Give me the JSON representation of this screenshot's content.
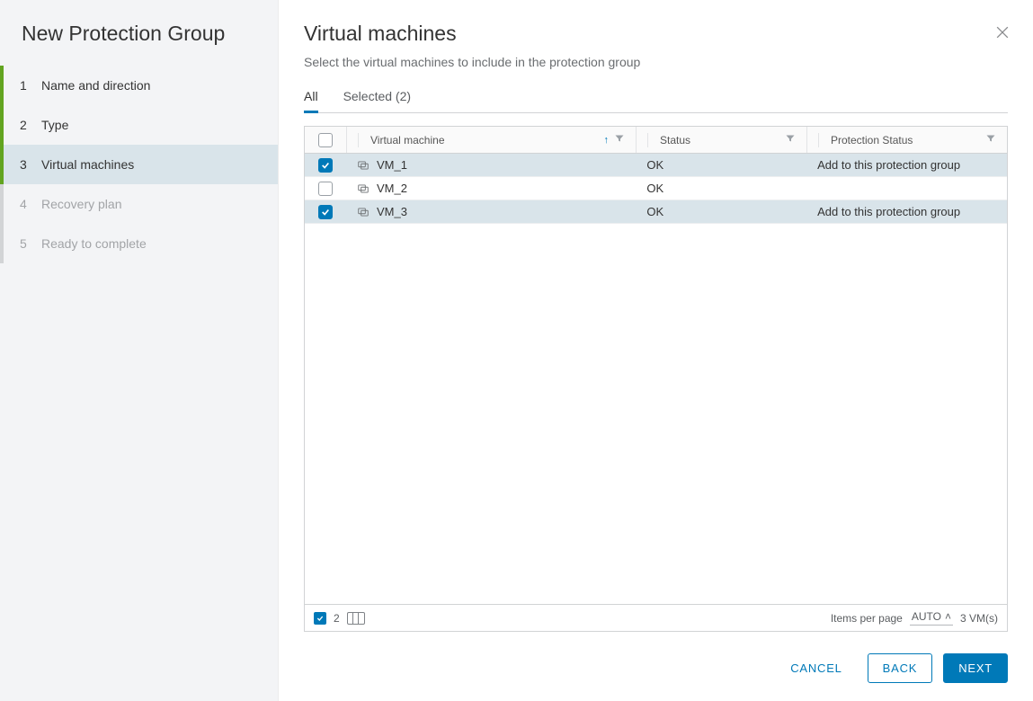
{
  "sidebar": {
    "title": "New Protection Group",
    "steps": [
      {
        "num": "1",
        "label": "Name and direction",
        "state": "done"
      },
      {
        "num": "2",
        "label": "Type",
        "state": "done"
      },
      {
        "num": "3",
        "label": "Virtual machines",
        "state": "active"
      },
      {
        "num": "4",
        "label": "Recovery plan",
        "state": "pending"
      },
      {
        "num": "5",
        "label": "Ready to complete",
        "state": "pending"
      }
    ]
  },
  "main": {
    "heading": "Virtual machines",
    "subtitle": "Select the virtual machines to include in the protection group",
    "tabs": {
      "all": "All",
      "selected": "Selected (2)"
    },
    "columns": {
      "vm": "Virtual machine",
      "status": "Status",
      "protection": "Protection Status"
    },
    "rows": [
      {
        "name": "VM_1",
        "status": "OK",
        "protection": "Add to this protection group",
        "checked": true
      },
      {
        "name": "VM_2",
        "status": "OK",
        "protection": "",
        "checked": false
      },
      {
        "name": "VM_3",
        "status": "OK",
        "protection": "Add to this protection group",
        "checked": true
      }
    ],
    "footer": {
      "selected_count": "2",
      "items_per_page_label": "Items per page",
      "items_per_page_value": "AUTO",
      "total_label": "3 VM(s)"
    }
  },
  "buttons": {
    "cancel": "CANCEL",
    "back": "BACK",
    "next": "NEXT"
  }
}
